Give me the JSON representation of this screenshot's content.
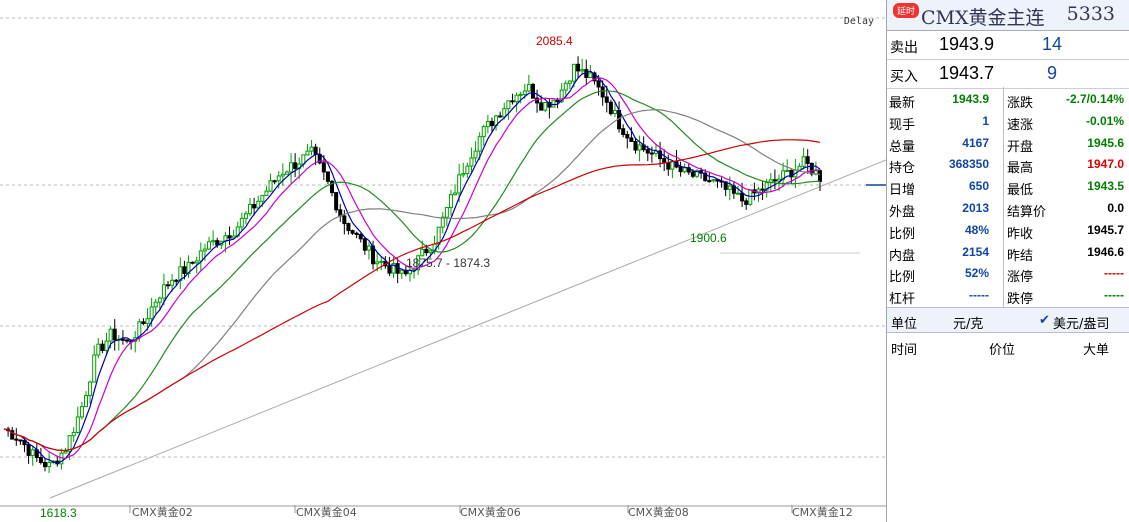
{
  "chart": {
    "delay_label": "Delay",
    "x_labels": [
      "CMX黄金02",
      "CMX黄金04",
      "CMX黄金06",
      "CMX黄金08",
      "CMX黄金12"
    ],
    "annotations": {
      "high": "2085.4",
      "low": "1618.3",
      "local_low": "1900.6",
      "gap": "1875.7 - 1874.3"
    },
    "colors": {
      "up": "#00a000",
      "down": "#000000",
      "ma_long": "#cc0000",
      "ma_mid": "#228b22",
      "ma_short": "#cc00cc",
      "ma_fast": "#0000aa",
      "ma_slow": "#808080"
    }
  },
  "chart_data": {
    "type": "candlestick",
    "title": "",
    "categories": [
      "CMX黄金02",
      "CMX黄金04",
      "CMX黄金06",
      "CMX黄金08",
      "CMX黄金12"
    ],
    "ylim": [
      1600,
      2110
    ],
    "marked_points": [
      {
        "label": "2085.4",
        "value": 2085.4
      },
      {
        "label": "1618.3",
        "value": 1618.3
      },
      {
        "label": "1900.6",
        "value": 1900.6
      }
    ],
    "close_trend": [
      1680,
      1670,
      1650,
      1640,
      1660,
      1700,
      1760,
      1780,
      1770,
      1790,
      1820,
      1840,
      1850,
      1870,
      1880,
      1890,
      1910,
      1930,
      1950,
      1960,
      1970,
      1940,
      1900,
      1880,
      1860,
      1850,
      1840,
      1860,
      1880,
      1920,
      1960,
      1990,
      2010,
      2030,
      2040,
      2020,
      2030,
      2060,
      2050,
      2030,
      2000,
      1980,
      1970,
      1960,
      1950,
      1945,
      1940,
      1930,
      1920,
      1930,
      1940,
      1950,
      1960,
      1945
    ]
  },
  "panel": {
    "badge": "延时",
    "title": "CMX黄金主连",
    "code": "5333",
    "sell": {
      "label": "卖出",
      "price": "1943.9",
      "vol": "14"
    },
    "buy": {
      "label": "买入",
      "price": "1943.7",
      "vol": "9"
    },
    "rows": [
      {
        "l1": "最新",
        "v1": "1943.9",
        "c1": "#008000",
        "l2": "涨跌",
        "v2": "-2.7/0.14%",
        "c2": "#008000"
      },
      {
        "l1": "现手",
        "v1": "1",
        "c1": "#1144aa",
        "l2": "速涨",
        "v2": "-0.01%",
        "c2": "#008000"
      },
      {
        "l1": "总量",
        "v1": "4167",
        "c1": "#1144aa",
        "l2": "开盘",
        "v2": "1945.6",
        "c2": "#008000"
      },
      {
        "l1": "持仓",
        "v1": "368350",
        "c1": "#1144aa",
        "l2": "最高",
        "v2": "1947.0",
        "c2": "#dd0000"
      },
      {
        "l1": "日增",
        "v1": "650",
        "c1": "#1144aa",
        "l2": "最低",
        "v2": "1943.5",
        "c2": "#008000"
      },
      {
        "l1": "外盘",
        "v1": "2013",
        "c1": "#1144aa",
        "l2": "结算价",
        "v2": "0.0",
        "c2": "#000000"
      },
      {
        "l1": "比例",
        "v1": "48%",
        "c1": "#1144aa",
        "l2": "昨收",
        "v2": "1945.7",
        "c2": "#000000"
      },
      {
        "l1": "内盘",
        "v1": "2154",
        "c1": "#1144aa",
        "l2": "昨结",
        "v2": "1946.6",
        "c2": "#000000"
      },
      {
        "l1": "比例",
        "v1": "52%",
        "c1": "#1144aa",
        "l2": "涨停",
        "v2": "-----",
        "c2": "#dd0000"
      },
      {
        "l1": "杠杆",
        "v1": "-----",
        "c1": "#1144aa",
        "l2": "跌停",
        "v2": "-----",
        "c2": "#008000"
      }
    ],
    "unit_label": "单位",
    "unit_value": "元/克",
    "unit_option": "美元/盎司",
    "headers": [
      "时间",
      "价位",
      "大单"
    ]
  }
}
